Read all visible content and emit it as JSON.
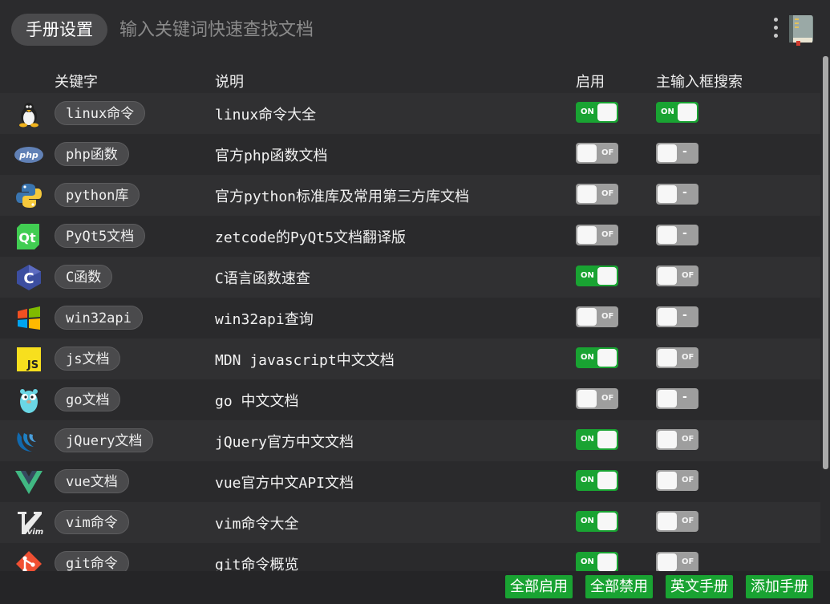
{
  "topbar": {
    "settings_label": "手册设置",
    "search_placeholder": "输入关键词快速查找文档"
  },
  "header": {
    "keyword": "关键字",
    "description": "说明",
    "enabled": "启用",
    "main_search": "主输入框搜索"
  },
  "toggle_labels": {
    "on": "ON",
    "off": "OF",
    "dash": "-"
  },
  "rows": [
    {
      "icon": "linux-tux-icon",
      "keyword": "linux命令",
      "desc": "linux命令大全",
      "enabled": "on",
      "main_search": "on"
    },
    {
      "icon": "php-icon",
      "keyword": "php函数",
      "desc": "官方php函数文档",
      "enabled": "off",
      "main_search": "dash"
    },
    {
      "icon": "python-icon",
      "keyword": "python库",
      "desc": "官方python标准库及常用第三方库文档",
      "enabled": "off",
      "main_search": "dash"
    },
    {
      "icon": "qt-icon",
      "keyword": "PyQt5文档",
      "desc": "zetcode的PyQt5文档翻译版",
      "enabled": "off",
      "main_search": "dash"
    },
    {
      "icon": "c-language-icon",
      "keyword": "C函数",
      "desc": "C语言函数速查",
      "enabled": "on",
      "main_search": "off"
    },
    {
      "icon": "windows-icon",
      "keyword": "win32api",
      "desc": "win32api查询",
      "enabled": "off",
      "main_search": "dash"
    },
    {
      "icon": "javascript-icon",
      "keyword": "js文档",
      "desc": "MDN javascript中文文档",
      "enabled": "on",
      "main_search": "off"
    },
    {
      "icon": "go-gopher-icon",
      "keyword": "go文档",
      "desc": "go 中文文档",
      "enabled": "off",
      "main_search": "dash"
    },
    {
      "icon": "jquery-icon",
      "keyword": "jQuery文档",
      "desc": "jQuery官方中文文档",
      "enabled": "on",
      "main_search": "off"
    },
    {
      "icon": "vue-icon",
      "keyword": "vue文档",
      "desc": "vue官方中文API文档",
      "enabled": "on",
      "main_search": "off"
    },
    {
      "icon": "vim-icon",
      "keyword": "vim命令",
      "desc": "vim命令大全",
      "enabled": "on",
      "main_search": "off"
    },
    {
      "icon": "git-icon",
      "keyword": "git命令",
      "desc": "git命令概览",
      "enabled": "on",
      "main_search": "off"
    }
  ],
  "footer": {
    "enable_all": "全部启用",
    "disable_all": "全部禁用",
    "english_manual": "英文手册",
    "add_manual": "添加手册"
  },
  "colors": {
    "background": "#2b2b2d",
    "toggle_on": "#19a332",
    "toggle_off": "#9e9e9e",
    "button": "#19a332"
  }
}
